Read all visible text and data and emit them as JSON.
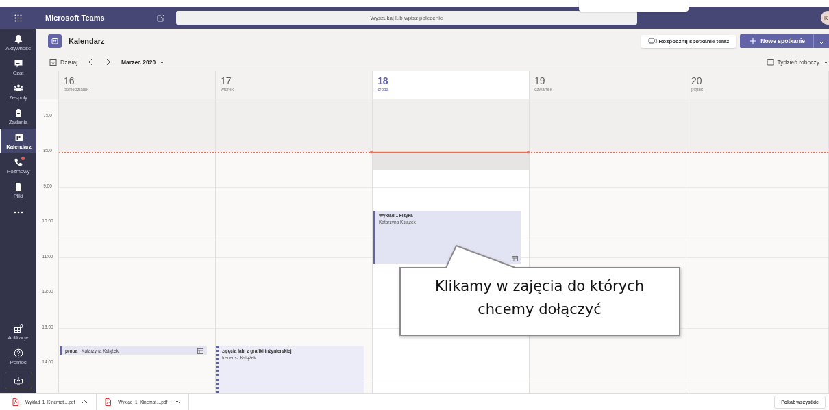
{
  "app": {
    "title": "Microsoft Teams",
    "search": {
      "placeholder": "Wyszukaj lub wpisz polecenie"
    },
    "avatar": "K"
  },
  "rail": {
    "items": [
      {
        "label": "Aktywność",
        "selected": false,
        "badge": false
      },
      {
        "label": "Czat",
        "selected": false,
        "badge": false
      },
      {
        "label": "Zespoły",
        "selected": false,
        "badge": false
      },
      {
        "label": "Zadania",
        "selected": false,
        "badge": false
      },
      {
        "label": "Kalendarz",
        "selected": true,
        "badge": false
      },
      {
        "label": "Rozmowy",
        "selected": false,
        "badge": true
      },
      {
        "label": "Pliki",
        "selected": false,
        "badge": false
      }
    ],
    "bottom": [
      {
        "label": "Aplikacje"
      },
      {
        "label": "Pomoc"
      }
    ]
  },
  "header": {
    "title": "Kalendarz",
    "meet_now": "Rozpocznij spotkanie teraz",
    "new_meeting": "Nowe spotkanie"
  },
  "toolbar": {
    "today": "Dzisiaj",
    "month": "Marzec 2020",
    "view": "Tydzień roboczy"
  },
  "hours": [
    "7:00",
    "8:00",
    "9:00",
    "10:00",
    "11:00",
    "12:00",
    "13:00",
    "14:00"
  ],
  "days": [
    {
      "number": "16",
      "name": "poniedziałek",
      "selected": false,
      "events": [
        {
          "kind": "short",
          "title": "proba",
          "organizer": "Katarzyna Książek",
          "online": true,
          "tentative": false
        }
      ]
    },
    {
      "number": "17",
      "name": "wtorek",
      "selected": false,
      "events": [
        {
          "kind": "long",
          "title": "zajęcia lab. z grafiki inżynierskiej",
          "organizer": "Ireneusz Książek",
          "online": false,
          "tentative": true
        }
      ]
    },
    {
      "number": "18",
      "name": "środa",
      "selected": true,
      "events": [
        {
          "kind": "long",
          "title": "Wykład 1 Fizyka",
          "organizer": "Katarzyna Książek",
          "online": true,
          "tentative": false
        }
      ]
    },
    {
      "number": "19",
      "name": "czwartek",
      "selected": false
    },
    {
      "number": "20",
      "name": "piątek",
      "selected": false
    }
  ],
  "callout": {
    "text": "Klikamy w zajęcia do których chcemy dołączyć"
  },
  "downloads": [
    {
      "name": "Wyklad_1_Kinemat....pdf"
    },
    {
      "name": "Wyklad_1_Kinemat....pdf"
    }
  ],
  "show_all": "Pokaż wszystkie"
}
